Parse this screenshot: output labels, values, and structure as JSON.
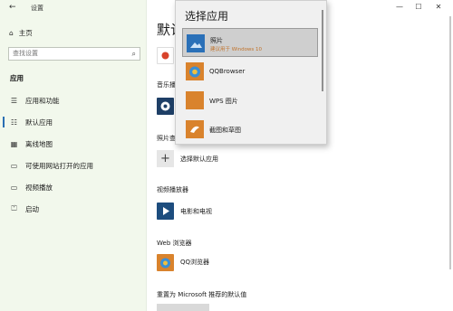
{
  "window": {
    "back_glyph": "←",
    "title": "设置",
    "minimize": "—",
    "maximize": "☐",
    "close": "✕"
  },
  "sidebar": {
    "home_label": "主页",
    "search_placeholder": "查找设置",
    "section_title": "应用",
    "items": [
      {
        "label": "应用和功能",
        "icon": "apps-list-icon"
      },
      {
        "label": "默认应用",
        "icon": "default-apps-icon",
        "active": true
      },
      {
        "label": "离线地图",
        "icon": "offline-map-icon"
      },
      {
        "label": "可使用网站打开的应用",
        "icon": "website-apps-icon"
      },
      {
        "label": "视频播放",
        "icon": "video-icon"
      },
      {
        "label": "启动",
        "icon": "startup-icon"
      }
    ]
  },
  "main": {
    "page_title": "默认应用",
    "music_label": "音乐播放器",
    "photo_label": "照片查看器",
    "choose_default_label": "选择默认应用",
    "video_label": "视频播放器",
    "video_app": "电影和电视",
    "web_label": "Web 浏览器",
    "web_app": "QQ浏览器",
    "reset_label": "重置为 Microsoft 推荐的默认值"
  },
  "popup": {
    "title": "选择应用",
    "options": [
      {
        "name": "照片",
        "subtitle": "建议用于 Windows 10",
        "selected": true
      },
      {
        "name": "QQBrowser"
      },
      {
        "name": "WPS 图片"
      },
      {
        "name": "截图和草图"
      }
    ]
  },
  "colors": {
    "sidebar_bg": "#f2f8ec",
    "accent": "#2b6fb3",
    "photo_blue": "#2a70b8",
    "orange": "#d9832d"
  }
}
